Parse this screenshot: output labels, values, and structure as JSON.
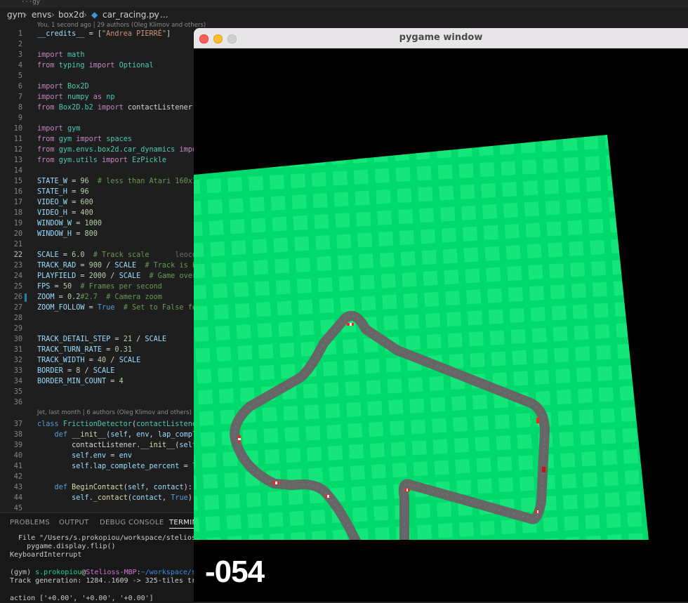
{
  "editor": {
    "tab_stub": "···gy",
    "breadcrumb": [
      "gym",
      "envs",
      "box2d",
      "car_racing.py",
      "..."
    ],
    "blame_top": "You, 1 second ago | 29 authors (Oleg Klimov and others)",
    "blame_mid": "Jet, last month | 6 authors (Oleg Klimov and others)",
    "inline_blame": "leocu"
  },
  "panel": {
    "tabs": [
      "PROBLEMS",
      "OUTPUT",
      "DEBUG CONSOLE",
      "TERMINAL"
    ],
    "terminal": [
      "  File \"/Users/s.prokopiou/workspace/stelios",
      "    pygame.display.flip()",
      "KeyboardInterrupt",
      "",
      "(gym) s.prokopiou@Stelioss-MBP:~/workspace/s",
      "Track generation: 1284..1609 -> 325-tiles tr",
      "",
      "action ['+0.00', '+0.00', '+0.00']"
    ]
  },
  "pygame": {
    "title": "pygame window",
    "score": "-054",
    "colors": {
      "grass": "#00d96b",
      "grass_tile": "#14e67a",
      "road": "#666666",
      "background": "#000000"
    }
  }
}
